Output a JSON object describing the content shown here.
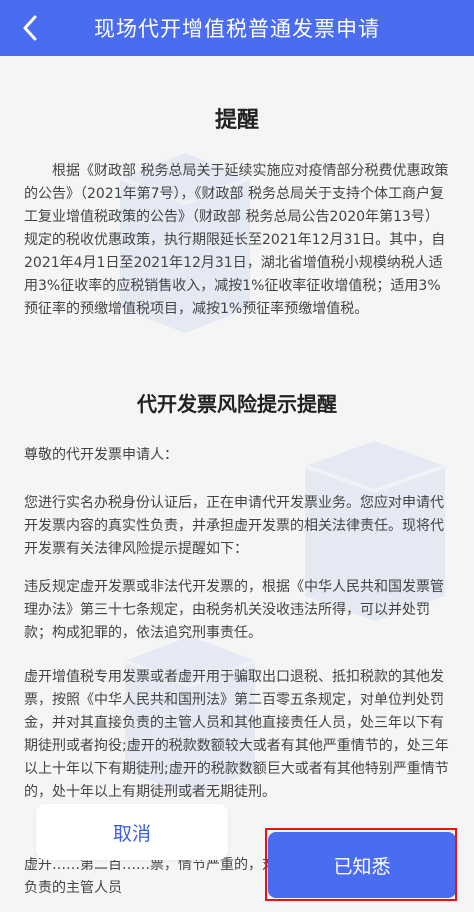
{
  "header": {
    "back_icon": "chevron-left-icon",
    "title": "现场代开增值税普通发票申请"
  },
  "notice": {
    "heading": "提醒",
    "body": "根据《财政部 税务总局关于延续实施应对疫情部分税费优惠政策的公告》（2021年第7号），《财政部 税务总局关于支持个体工商户复工复业增值税政策的公告》（财政部 税务总局公告2020年第13号）规定的税收优惠政策，执行期限延长至2021年12月31日。其中，自2021年4月1日至2021年12月31日，湖北省增值税小规模纳税人适用3%征收率的应税销售收入，减按1%征收率征收增值税；适用3%预征率的预缴增值税项目，减按1%预征率预缴增值税。"
  },
  "risk": {
    "heading": "代开发票风险提示提醒",
    "salutation": "尊敬的代开发票申请人：",
    "paragraphs": [
      "您进行实名办税身份认证后，正在申请代开发票业务。您应对申请代开发票内容的真实性负责，并承担虚开发票的相关法律责任。现将代开发票有关法律风险提示提醒如下：",
      "违反规定虚开发票或非法代开发票的，根据《中华人民共和国发票管理办法》第三十七条规定，由税务机关没收违法所得，可以并处罚款；构成犯罪的，依法追究刑事责任。",
      "虚开增值税专用发票或者虚开用于骗取出口退税、抵扣税款的其他发票，按照《中华人民共和国刑法》第二百零五条规定，对单位判处罚金，并对其直接负责的主管人员和其他直接责任人员，处三年以下有期徒刑或者拘役;虚开的税款数额较大或者有其他严重情节的，处三年以上十年以下有期徒刑;虚开的税款数额巨大或者有其他特别严重情节的，处十年以上有期徒刑或者无期徒刑。",
      "虚开……第二百……票，情节严重的，对单位判处罚金，并对其直接负责的主管人员"
    ]
  },
  "actions": {
    "cancel_label": "取消",
    "confirm_label": "已知悉"
  },
  "colors": {
    "primary": "#4a6cf0",
    "highlight": "#e11111"
  }
}
